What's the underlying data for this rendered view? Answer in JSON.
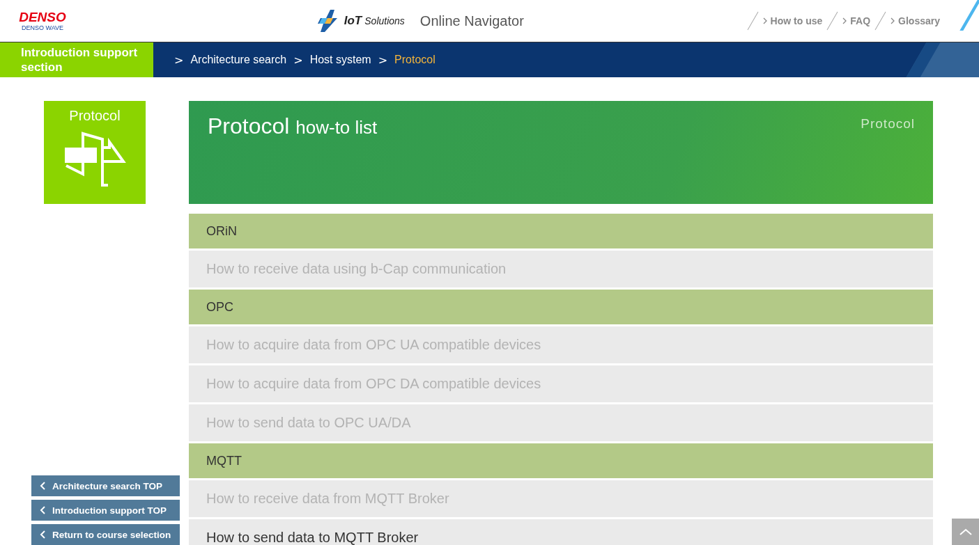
{
  "header": {
    "brand": "DENSO",
    "brand_sub": "DENSO WAVE",
    "product": "IoT",
    "product_sub": "Solutions",
    "title": "Online Navigator",
    "nav": [
      "How to use",
      "FAQ",
      "Glossary"
    ]
  },
  "section_label": "Introduction support section",
  "breadcrumb": [
    {
      "prefix": ">",
      "label": "Architecture search",
      "selected": false
    },
    {
      "prefix": ">",
      "label": "Host system",
      "selected": false
    },
    {
      "prefix": ">",
      "label": "Protocol",
      "selected": true
    }
  ],
  "tile": {
    "label": "Protocol"
  },
  "banner": {
    "title": "Protocol",
    "subtitle": "how-to list",
    "tag": "Protocol"
  },
  "list": [
    {
      "kind": "category",
      "label": "ORiN"
    },
    {
      "kind": "link",
      "label": "How to receive data using b-Cap communication",
      "disabled": true
    },
    {
      "kind": "category",
      "label": "OPC"
    },
    {
      "kind": "link",
      "label": "How to acquire data from OPC UA compatible devices",
      "disabled": true
    },
    {
      "kind": "link",
      "label": "How to acquire data from OPC DA compatible devices",
      "disabled": true
    },
    {
      "kind": "link",
      "label": "How to send data to OPC UA/DA",
      "disabled": true
    },
    {
      "kind": "category",
      "label": "MQTT"
    },
    {
      "kind": "link",
      "label": "How to receive data from MQTT Broker",
      "disabled": true
    },
    {
      "kind": "link",
      "label": "How to send data to MQTT Broker",
      "disabled": false
    }
  ],
  "side_buttons": [
    "Architecture search TOP",
    "Introduction support TOP",
    "Return to course selection"
  ]
}
